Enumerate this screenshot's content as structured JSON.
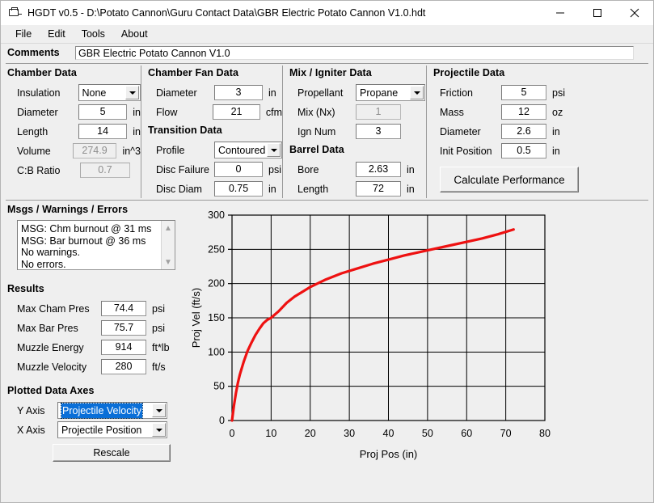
{
  "window": {
    "title": "HGDT v0.5 - D:\\Potato Cannon\\Guru Contact Data\\GBR Electric Potato Cannon V1.0.hdt",
    "icon": "folder-document-icon",
    "minimize": "–",
    "maximize": "□",
    "close": "✕"
  },
  "menu": {
    "items": [
      "File",
      "Edit",
      "Tools",
      "About"
    ]
  },
  "comments": {
    "label": "Comments",
    "value": "GBR Electric Potato Cannon V1.0",
    "placeholder": ""
  },
  "chamber_data": {
    "title": "Chamber Data",
    "rows": [
      {
        "label": "Insulation",
        "value": "None",
        "unit": "",
        "type": "combo",
        "readonly": false
      },
      {
        "label": "Diameter",
        "value": "5",
        "unit": "in",
        "type": "text",
        "readonly": false
      },
      {
        "label": "Length",
        "value": "14",
        "unit": "in",
        "type": "text",
        "readonly": false
      },
      {
        "label": "Volume",
        "value": "274.9",
        "unit": "in^3",
        "type": "text",
        "readonly": true
      },
      {
        "label": "C:B Ratio",
        "value": "0.7",
        "unit": "",
        "type": "text",
        "readonly": true
      }
    ]
  },
  "chamber_fan_data": {
    "title": "Chamber Fan Data",
    "rows": [
      {
        "label": "Diameter",
        "value": "3",
        "unit": "in",
        "type": "text",
        "readonly": false
      },
      {
        "label": "Flow",
        "value": "21",
        "unit": "cfm",
        "type": "text",
        "readonly": false
      }
    ]
  },
  "transition_data": {
    "title": "Transition Data",
    "rows": [
      {
        "label": "Profile",
        "value": "Contoured",
        "unit": "",
        "type": "combo",
        "readonly": false
      },
      {
        "label": "Disc Failure",
        "value": "0",
        "unit": "psi",
        "type": "text",
        "readonly": false
      },
      {
        "label": "Disc Diam",
        "value": "0.75",
        "unit": "in",
        "type": "text",
        "readonly": false
      }
    ]
  },
  "mix_igniter_data": {
    "title": "Mix / Igniter Data",
    "rows": [
      {
        "label": "Propellant",
        "value": "Propane",
        "unit": "",
        "type": "combo",
        "readonly": false
      },
      {
        "label": "Mix (Nx)",
        "value": "1",
        "unit": "",
        "type": "text",
        "readonly": true
      },
      {
        "label": "Ign Num",
        "value": "3",
        "unit": "",
        "type": "text",
        "readonly": false
      }
    ]
  },
  "barrel_data": {
    "title": "Barrel Data",
    "rows": [
      {
        "label": "Bore",
        "value": "2.63",
        "unit": "in",
        "type": "text",
        "readonly": false
      },
      {
        "label": "Length",
        "value": "72",
        "unit": "in",
        "type": "text",
        "readonly": false
      }
    ]
  },
  "projectile_data": {
    "title": "Projectile Data",
    "rows": [
      {
        "label": "Friction",
        "value": "5",
        "unit": "psi",
        "type": "text",
        "readonly": false
      },
      {
        "label": "Mass",
        "value": "12",
        "unit": "oz",
        "type": "text",
        "readonly": false
      },
      {
        "label": "Diameter",
        "value": "2.6",
        "unit": "in",
        "type": "text",
        "readonly": false
      },
      {
        "label": "Init Position",
        "value": "0.5",
        "unit": "in",
        "type": "text",
        "readonly": false
      }
    ],
    "calculate_button": "Calculate Performance"
  },
  "messages": {
    "title": "Msgs / Warnings / Errors",
    "lines": [
      "MSG: Chm burnout @ 31 ms",
      "MSG: Bar burnout @ 36 ms",
      "No warnings.",
      "No errors."
    ],
    "scroll_up": "▲",
    "scroll_down": "▼"
  },
  "results": {
    "title": "Results",
    "rows": [
      {
        "label": "Max Cham Pres",
        "value": "74.4",
        "unit": "psi"
      },
      {
        "label": "Max Bar Pres",
        "value": "75.7",
        "unit": "psi"
      },
      {
        "label": "Muzzle Energy",
        "value": "914",
        "unit": "ft*lb"
      },
      {
        "label": "Muzzle Velocity",
        "value": "280",
        "unit": "ft/s"
      }
    ]
  },
  "plotted_data_axes": {
    "title": "Plotted Data Axes",
    "y_axis": {
      "label": "Y Axis",
      "value": "Projectile Velocity",
      "selected": true
    },
    "x_axis": {
      "label": "X Axis",
      "value": "Projectile Position",
      "selected": false
    },
    "rescale_button": "Rescale"
  },
  "chart_data": {
    "type": "line",
    "title": "",
    "xlabel": "Proj Pos (in)",
    "ylabel": "Proj Vel (ft/s)",
    "xlim": [
      0,
      80
    ],
    "ylim": [
      0,
      300
    ],
    "xticks": [
      0,
      10,
      20,
      30,
      40,
      50,
      60,
      70,
      80
    ],
    "yticks": [
      0,
      50,
      100,
      150,
      200,
      250,
      300
    ],
    "grid": true,
    "legend": "none",
    "series": [
      {
        "name": "Projectile Velocity",
        "color": "#ee1111",
        "x": [
          0,
          0.5,
          1,
          1.5,
          2,
          3,
          4,
          5,
          6,
          7,
          8,
          9,
          10,
          12,
          14,
          16,
          18,
          20,
          24,
          28,
          32,
          36,
          40,
          44,
          48,
          52,
          56,
          60,
          64,
          68,
          72
        ],
        "y": [
          0,
          22,
          40,
          55,
          67,
          86,
          102,
          114,
          125,
          134,
          142,
          147,
          150,
          160,
          172,
          181,
          188,
          195,
          206,
          215,
          222,
          229,
          235,
          241,
          246,
          251,
          256,
          261,
          266,
          272,
          279
        ]
      }
    ]
  }
}
